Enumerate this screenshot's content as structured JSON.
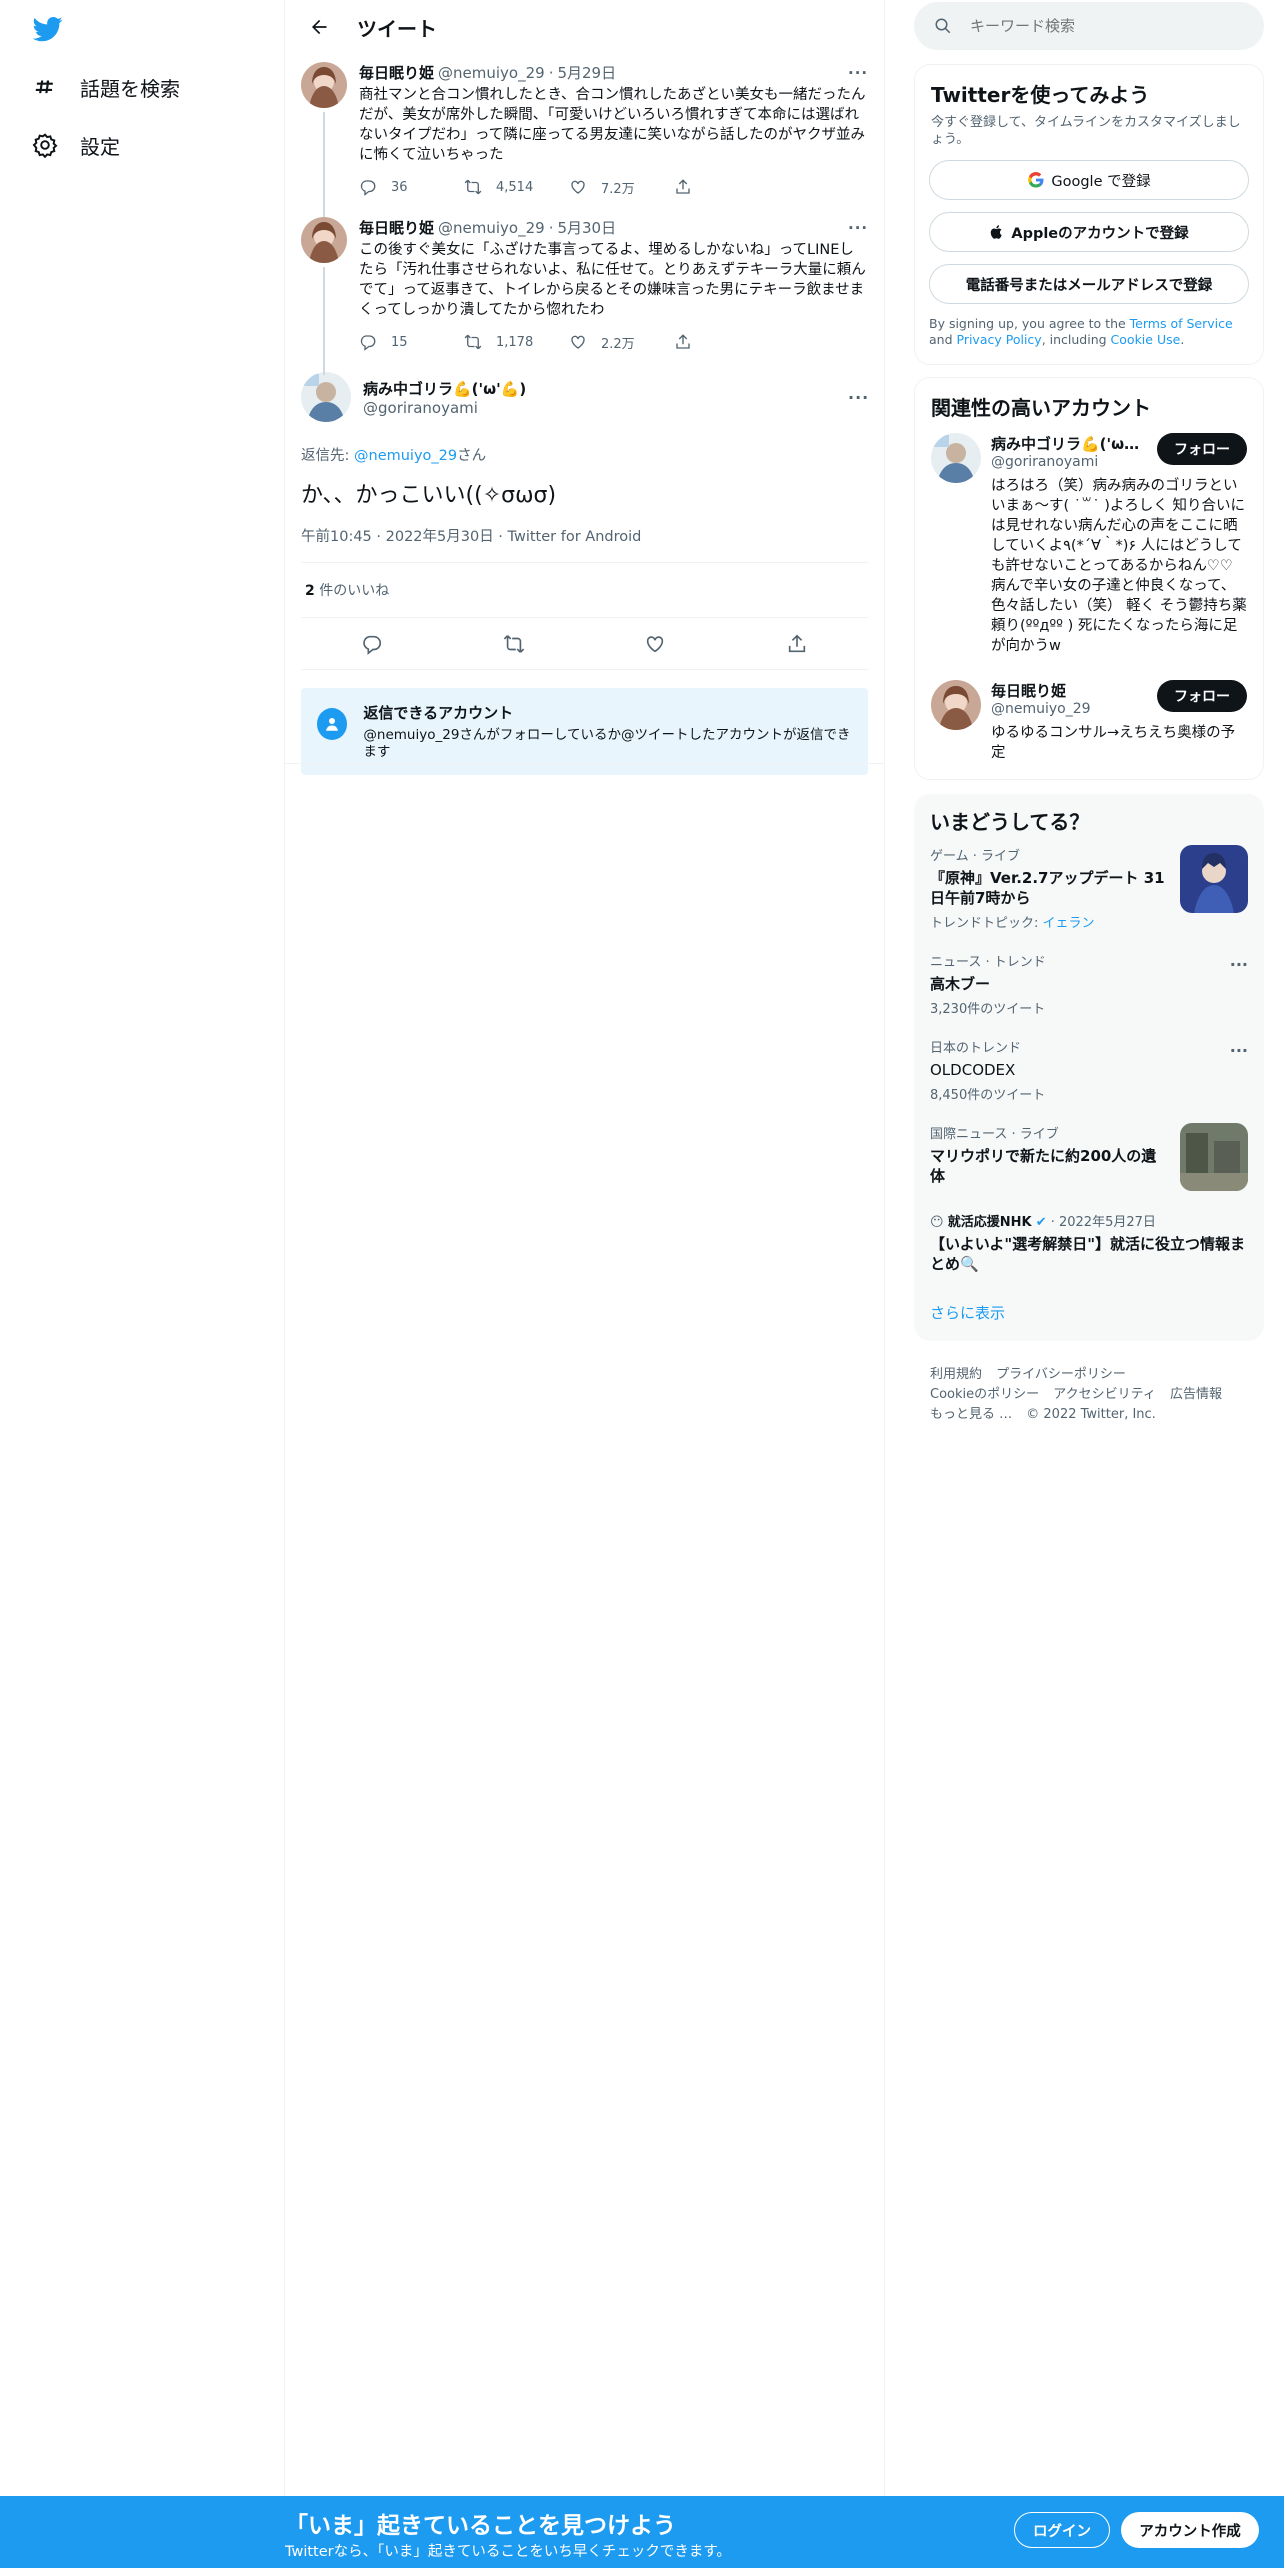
{
  "nav": {
    "explore_label": "話題を検索",
    "settings_label": "設定"
  },
  "header": {
    "title": "ツイート"
  },
  "thread": [
    {
      "name": "毎日眠り姫",
      "handle": "@nemuiyo_29",
      "date": "5月29日",
      "text": "商社マンと合コン慣れしたとき、合コン慣れしたあざとい美女も一緒だったんだが、美女が席外した瞬間、「可愛いけどいろいろ慣れすぎて本命には選ばれないタイプだわ」って隣に座ってる男友達に笑いながら話したのがヤクザ並みに怖くて泣いちゃった",
      "replies": "36",
      "retweets": "4,514",
      "likes": "7.2万"
    },
    {
      "name": "毎日眠り姫",
      "handle": "@nemuiyo_29",
      "date": "5月30日",
      "text": "この後すぐ美女に「ふざけた事言ってるよ、埋めるしかないね」ってLINEしたら「汚れ仕事させられないよ、私に任せて。とりあえずテキーラ大量に頼んでて」って返事きて、トイレから戻るとその嫌味言った男にテキーラ飲ませまくってしっかり潰してたから惚れたわ",
      "replies": "15",
      "retweets": "1,178",
      "likes": "2.2万"
    }
  ],
  "main_tweet": {
    "name": "病み中ゴリラ💪('ω'💪)",
    "handle": "@goriranoyami",
    "reply_prefix": "返信先: ",
    "reply_to": "@nemuiyo_29",
    "reply_suffix": "さん",
    "text": "か、、かっこいい((✧σωσ)",
    "timestamp": "午前10:45 · 2022年5月30日 · Twitter for Android",
    "like_count": "2",
    "like_label": " 件のいいね",
    "reply_box_title": "返信できるアカウント",
    "reply_box_text": "@nemuiyo_29さんがフォローしているか@ツイートしたアカウントが返信できます"
  },
  "search": {
    "placeholder": "キーワード検索"
  },
  "signup_card": {
    "title": "Twitterを使ってみよう",
    "subtitle": "今すぐ登録して、タイムラインをカスタマイズしましょう。",
    "google_label": "Google で登録",
    "apple_label": "Appleのアカウントで登録",
    "phone_label": "電話番号またはメールアドレスで登録",
    "terms_prefix": "By signing up, you agree to the ",
    "terms_link": "Terms of Service",
    "terms_and": " and ",
    "privacy_link": "Privacy Policy",
    "cookie_prefix": ", including ",
    "cookie_link": "Cookie Use",
    "terms_end": "."
  },
  "relevant": {
    "title": "関連性の高いアカウント",
    "follow_label": "フォロー",
    "accounts": [
      {
        "name": "病み中ゴリラ💪('ω'💪)",
        "handle": "@goriranoyami",
        "bio": "はろはろ（笑）病み病みのゴリラといいまぁ〜す( ˙꒳˙ )よろしく 知り合いには見せれない病んだ心の声をここに晒していくよ٩(*´∀｀*)۶ 人にはどうしても許せないことってあるからねん♡♡ 病んで辛い女の子達と仲良くなって、色々話したい（笑） 軽く そう鬱持ち薬頼り(ººдºº ) 死にたくなったら海に足が向かうw"
      },
      {
        "name": "毎日眠り姫",
        "handle": "@nemuiyo_29",
        "bio": "ゆるゆるコンサル→えちえち奥様の予定"
      }
    ]
  },
  "trends": {
    "title": "いまどうしてる？",
    "items": [
      {
        "context": "ゲーム · ライブ",
        "title": "『原神』Ver.2.7アップデート 31日午前7時から",
        "meta_prefix": "トレンドトピック: ",
        "meta_link": "イェラン"
      },
      {
        "context": "ニュース · トレンド",
        "title": "高木ブー",
        "count": "3,230件のツイート"
      },
      {
        "context": "日本のトレンド",
        "title": "OLDCODEX",
        "count": "8,450件のツイート"
      },
      {
        "context": "国際ニュース · ライブ",
        "title": "マリウポリで新たに約200人の遺体"
      },
      {
        "context_name": "就活応援NHK",
        "context_date": " · 2022年5月27日",
        "title": "【いよいよ\"選考解禁日\"】就活に役立つ情報まとめ🔍"
      }
    ],
    "show_more": "さらに表示"
  },
  "footer": {
    "terms": "利用規約",
    "privacy": "プライバシーポリシー",
    "cookie": "Cookieのポリシー",
    "accessibility": "アクセシビリティ",
    "ads": "広告情報",
    "more": "もっと見る …",
    "copyright": "© 2022 Twitter, Inc."
  },
  "banner": {
    "title": "「いま」起きていることを見つけよう",
    "subtitle": "Twitterなら、「いま」起きていることをいち早くチェックできます。",
    "login_label": "ログイン",
    "signup_label": "アカウント作成"
  },
  "colors": {
    "accent": "#1d9bf0",
    "text": "#0f1419",
    "muted": "#536471"
  }
}
